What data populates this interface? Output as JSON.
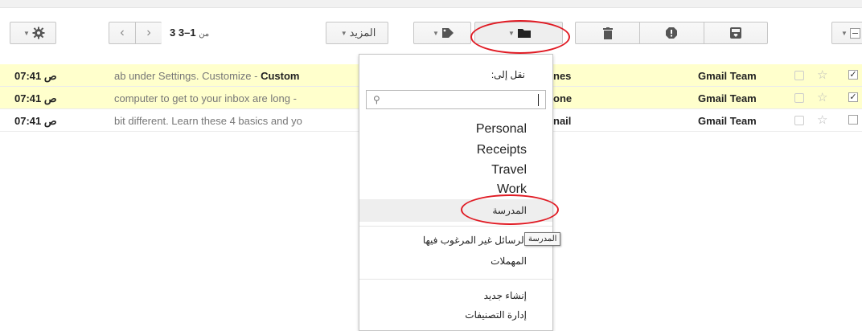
{
  "toolbar": {
    "archive_icon": "archive-icon",
    "spam_icon": "report-spam-icon",
    "delete_icon": "trash-icon",
    "move_to_icon": "folder-icon",
    "labels_icon": "tag-icon",
    "more_label": "المزيد",
    "settings_icon": "gear-icon",
    "pager_range": "1–3",
    "pager_of": "من",
    "pager_total": "3"
  },
  "emails": [
    {
      "time": "07:41 ص",
      "snippet": "ab under Settings. Customize - ",
      "snippet_bold": "Custom",
      "subject_tail": "nes",
      "sender": "Gmail Team",
      "checked": "✓"
    },
    {
      "time": "07:41 ص",
      "snippet": "computer to get to your inbox are long - ",
      "snippet_bold": "",
      "subject_tail": "one",
      "sender": "Gmail Team",
      "checked": "✓"
    },
    {
      "time": "07:41 ص",
      "snippet": "bit different. Learn these 4 basics and yo",
      "snippet_bold": "",
      "subject_tail": "nail",
      "sender": "Gmail Team",
      "checked": ""
    }
  ],
  "move_menu": {
    "title": "نقل إلى:",
    "search_placeholder": "",
    "folders": [
      "Personal",
      "Receipts",
      "Travel",
      "Work"
    ],
    "highlighted": "المدرسة",
    "spam": "الرسائل غير المرغوب فيها",
    "trash": "المهملات",
    "create_new": "إنشاء جديد",
    "manage_labels": "إدارة التصنيفات"
  },
  "tooltip": "المدرسة",
  "colors": {
    "selected_row": "#ffffcc",
    "annotation": "#e01b24"
  }
}
